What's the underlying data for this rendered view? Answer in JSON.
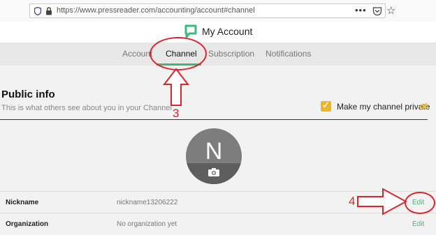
{
  "browser": {
    "url": "https://www.pressreader.com/accounting/account#channel",
    "menu_dots": "•••",
    "star_glyph": "☆"
  },
  "header": {
    "title": "My Account",
    "brand_color": "#3cb878"
  },
  "tabs": [
    {
      "label": "Account",
      "active": false
    },
    {
      "label": "Channel",
      "active": true
    },
    {
      "label": "Subscription",
      "active": false
    },
    {
      "label": "Notifications",
      "active": false
    }
  ],
  "public_info": {
    "title": "Public info",
    "description": "This is what others see about you in your Channel",
    "private_label": "Make my channel private",
    "private_checked": true,
    "checkbox_color": "#f0b429"
  },
  "avatar": {
    "letter": "N"
  },
  "rows": [
    {
      "label": "Nickname",
      "value": "nickname13206222",
      "action": "Edit"
    },
    {
      "label": "Organization",
      "value": "No organization yet",
      "action": "Edit"
    }
  ],
  "annotations": {
    "step_a": "3",
    "step_b": "4",
    "color": "#d9262d"
  }
}
